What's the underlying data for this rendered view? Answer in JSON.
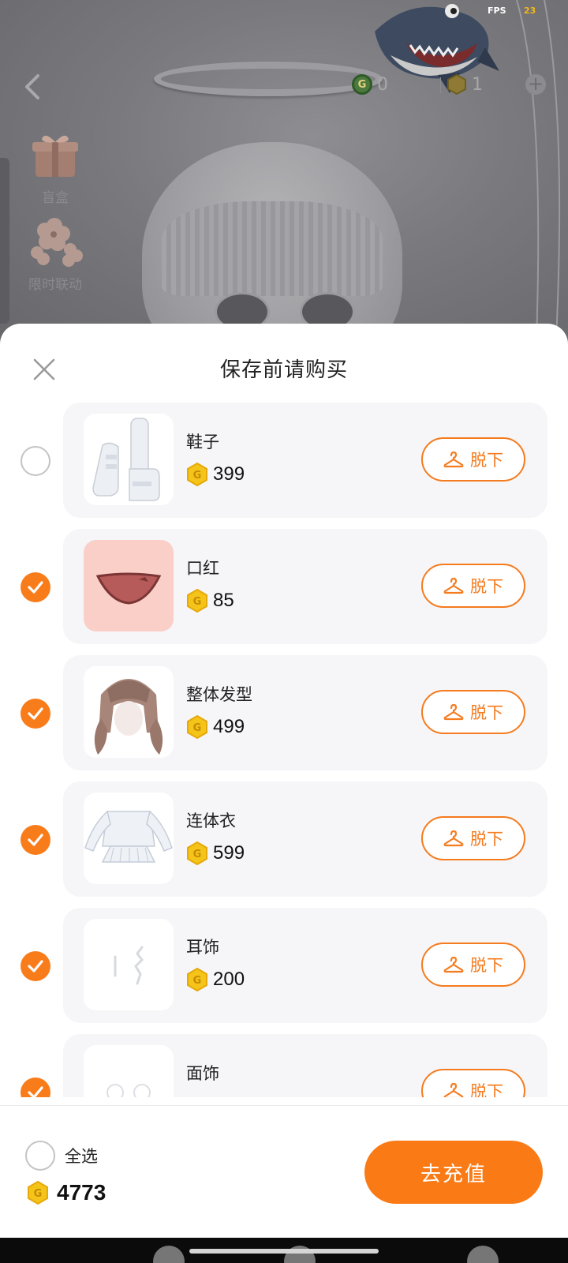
{
  "status": {
    "fps_label": "FPS",
    "fps_value": "23"
  },
  "top_bar": {
    "g_coin_count": "0",
    "token_count": "1"
  },
  "side_menu": [
    {
      "label": "盲盒",
      "icon": "gift-box-icon"
    },
    {
      "label": "限时联动",
      "icon": "flower-icon"
    }
  ],
  "sheet": {
    "title": "保存前请购买",
    "items": [
      {
        "name": "鞋子",
        "price": "399",
        "checked": false,
        "action": "脱下",
        "thumb": "boots"
      },
      {
        "name": "口红",
        "price": "85",
        "checked": true,
        "action": "脱下",
        "thumb": "lips"
      },
      {
        "name": "整体发型",
        "price": "499",
        "checked": true,
        "action": "脱下",
        "thumb": "hair"
      },
      {
        "name": "连体衣",
        "price": "599",
        "checked": true,
        "action": "脱下",
        "thumb": "outfit"
      },
      {
        "name": "耳饰",
        "price": "200",
        "checked": true,
        "action": "脱下",
        "thumb": "earring"
      },
      {
        "name": "面饰",
        "price": "",
        "checked": true,
        "action": "脱下",
        "thumb": "face"
      }
    ]
  },
  "footer": {
    "select_all_label": "全选",
    "balance": "4773",
    "recharge_label": "去充值"
  },
  "colors": {
    "accent": "#f97c1b",
    "coin": "#f5c418"
  }
}
